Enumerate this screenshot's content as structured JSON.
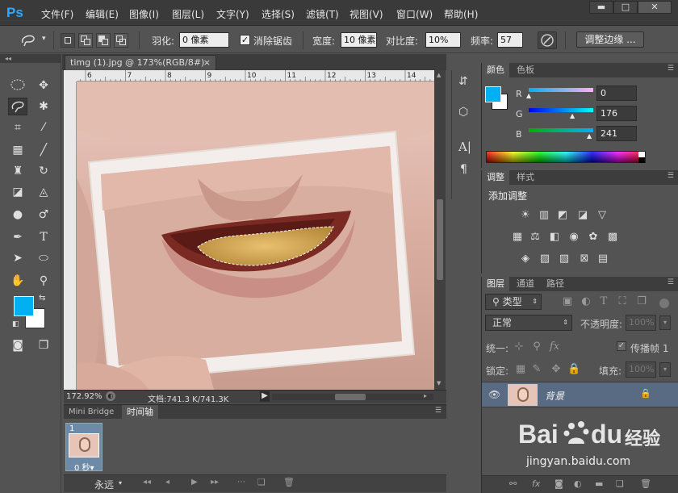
{
  "menubar": {
    "logo": "Ps",
    "items": [
      "文件(F)",
      "编辑(E)",
      "图像(I)",
      "图层(L)",
      "文字(Y)",
      "选择(S)",
      "滤镜(T)",
      "视图(V)",
      "窗口(W)",
      "帮助(H)"
    ],
    "win_buttons": {
      "min": "▬",
      "max": "□",
      "close": "✕"
    }
  },
  "options": {
    "feather_label": "羽化:",
    "feather_value": "0 像素",
    "antialias_label": "消除锯齿",
    "width_label": "宽度:",
    "width_value": "10 像素",
    "contrast_label": "对比度:",
    "contrast_value": "10%",
    "frequency_label": "频率:",
    "frequency_value": "57",
    "refine_edge": "调整边缘 ..."
  },
  "document": {
    "tab_title": "timg (1).jpg @ 173%(RGB/8#)",
    "close": "×",
    "ruler_marks": [
      "6",
      "7",
      "8",
      "9",
      "10",
      "11",
      "12",
      "13",
      "14"
    ],
    "zoom": "172.92%",
    "doc_info": "文档:741.3 K/741.3K"
  },
  "timeline": {
    "tabs": [
      "Mini Bridge",
      "时间轴"
    ],
    "frame_number": "1",
    "frame_time": "0 秒▾",
    "loop": "永远"
  },
  "color_panel": {
    "tabs": [
      "颜色",
      "色板"
    ],
    "r_label": "R",
    "r_value": "0",
    "g_label": "G",
    "g_value": "176",
    "b_label": "B",
    "b_value": "241",
    "foreground": "#00b0f1"
  },
  "adjust_panel": {
    "tabs": [
      "调整",
      "样式"
    ],
    "heading": "添加调整"
  },
  "layers_panel": {
    "tabs": [
      "图层",
      "通道",
      "路径"
    ],
    "filter_kind": "类型",
    "blend_mode": "正常",
    "opacity_label": "不透明度:",
    "opacity_value": "100%",
    "unify_label": "统一:",
    "propagate_label": "传播帧 1",
    "lock_label": "锁定:",
    "fill_label": "填充:",
    "fill_value": "100%",
    "layer_name": "背景"
  },
  "watermark": {
    "brand": "Bai",
    "brand2": "du",
    "suffix": "经验",
    "url": "jingyan.baidu.com"
  }
}
